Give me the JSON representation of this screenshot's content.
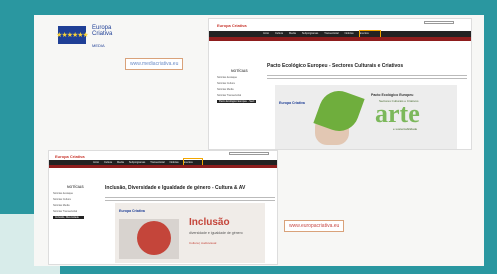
{
  "brand": {
    "logo_icon": "eu-flag-icon",
    "line1": "Europa",
    "line2": "Criativa",
    "line3": "MEDIA"
  },
  "urls": {
    "left": "www.mediacriativa.eu",
    "right": "www.europacriativa.eu"
  },
  "screenshot_a": {
    "logo": "Europa Criativa",
    "nav": [
      "Início",
      "Cultura",
      "Media",
      "Subprogramas",
      "Transectorial",
      "Notícias",
      "Eventos",
      "Apoios",
      "Multimédia",
      "Contactos"
    ],
    "highlight_nav": "Notícias",
    "title": "Pacto Ecológico Europeu - Sectores Culturais e Criativos",
    "sidebar_heading": "NOTÍCIAS",
    "sidebar": [
      "Notícias destaque",
      "Notícias Cultura",
      "Notícias Media",
      "Notícias Transectorial",
      "Pacto Ecológico Europeu - Sect"
    ],
    "hero_title": "Pacto Ecológico Europeu",
    "hero_sub": "Sectores Culturais e Criativos",
    "hero_word": "arte",
    "hero_word_sub": "e sustentabilidade",
    "hero_brand": "Europa Criativa"
  },
  "screenshot_b": {
    "logo": "Europa Criativa",
    "nav": [
      "Início",
      "Cultura",
      "Media",
      "Subprogramas",
      "Transectorial",
      "Notícias",
      "Eventos",
      "Apoios",
      "Multimédia"
    ],
    "highlight_nav": "Notícias",
    "title": "Inclusão, Diversidade e Igualdade de género - Cultura & AV",
    "sidebar_heading": "NOTÍCIAS",
    "sidebar": [
      "Notícias destaque",
      "Notícias Cultura",
      "Notícias Media",
      "Notícias Transectorial",
      "Inclusão, Diversidade"
    ],
    "hero_brand": "Europa Criativa",
    "hero_word": "Inclusão",
    "hero_line": "diversidade e igualdade de género",
    "hero_strip": "Cultura | Audiovisual"
  }
}
